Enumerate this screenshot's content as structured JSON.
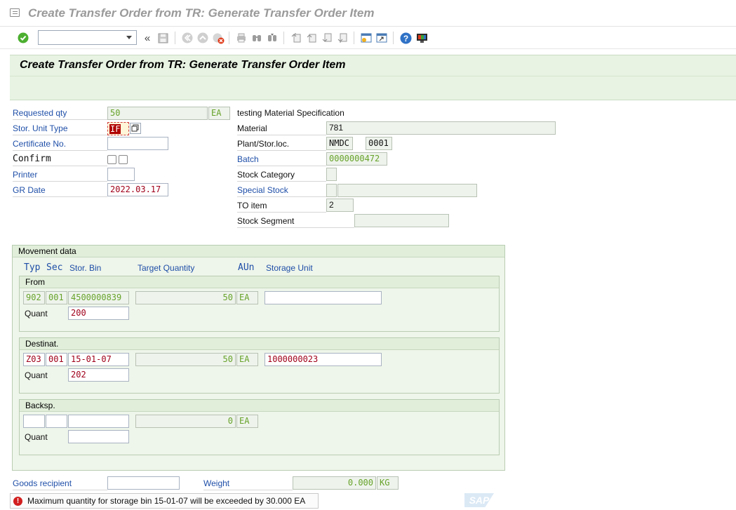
{
  "window": {
    "title": "Create Transfer Order from TR: Generate Transfer Order Item"
  },
  "toolbar": {
    "command_value": "",
    "icons": [
      "check-icon",
      "back-arrows-icon",
      "save-icon",
      "back-icon",
      "exit-icon",
      "cancel-icon",
      "print-icon",
      "find-icon",
      "find-next-icon",
      "first-page-icon",
      "prev-page-icon",
      "next-page-icon",
      "last-page-icon",
      "new-session-icon",
      "shortcut-icon",
      "help-icon",
      "customize-layout-icon"
    ]
  },
  "screen": {
    "heading": "Create Transfer Order from TR: Generate Transfer Order Item"
  },
  "left_fields": {
    "requested_qty": {
      "label": "Requested qty",
      "value": "50",
      "unit": "EA"
    },
    "stor_unit_type": {
      "label": "Stor. Unit Type",
      "value": "IF"
    },
    "certificate_no": {
      "label": "Certificate No.",
      "value": ""
    },
    "confirm": {
      "label": "Confirm"
    },
    "printer": {
      "label": "Printer",
      "value": ""
    },
    "gr_date": {
      "label": "GR Date",
      "value": "2022.03.17"
    }
  },
  "right_fields": {
    "material_desc": "testing Material Specification",
    "material": {
      "label": "Material",
      "value": "781"
    },
    "plant_storloc": {
      "label": "Plant/Stor.loc.",
      "plant": "NMDC",
      "sloc": "0001"
    },
    "batch": {
      "label": "Batch",
      "value": "0000000472"
    },
    "stock_category": {
      "label": "Stock Category",
      "value": ""
    },
    "special_stock": {
      "label": "Special Stock",
      "value": "",
      "desc": ""
    },
    "to_item": {
      "label": "TO item",
      "value": "2"
    },
    "stock_segment": {
      "label": "Stock Segment",
      "value": ""
    }
  },
  "movement": {
    "title": "Movement data",
    "columns": {
      "typ": "Typ",
      "sec": "Sec",
      "bin": "Stor. Bin",
      "target_qty": "Target Quantity",
      "aun": "AUn",
      "storage_unit": "Storage Unit"
    },
    "quant_label": "Quant",
    "from": {
      "title": "From",
      "typ": "902",
      "sec": "001",
      "bin": "4500000839",
      "qty": "50",
      "unit": "EA",
      "storage_unit": "",
      "quant": "200"
    },
    "destinat": {
      "title": "Destinat.",
      "typ": "Z03",
      "sec": "001",
      "bin": "15-01-07",
      "qty": "50",
      "unit": "EA",
      "storage_unit": "1000000023",
      "quant": "202"
    },
    "backsp": {
      "title": "Backsp.",
      "typ": "",
      "sec": "",
      "bin": "",
      "qty": "0",
      "unit": "EA",
      "quant": ""
    }
  },
  "bottom": {
    "goods_recipient": {
      "label": "Goods recipient",
      "value": ""
    },
    "weight": {
      "label": "Weight",
      "value": "0.000",
      "unit": "KG"
    }
  },
  "status": {
    "message": "Maximum quantity for storage bin 15-01-07 will be exceeded by 30.000 EA"
  },
  "logo": {
    "text": "SAP"
  },
  "colors": {
    "label_blue": "#1f4fa8",
    "value_green": "#67a32a",
    "value_red": "#a0001a",
    "header_green": "#e8f3e3",
    "error_red": "#d21f1f"
  }
}
